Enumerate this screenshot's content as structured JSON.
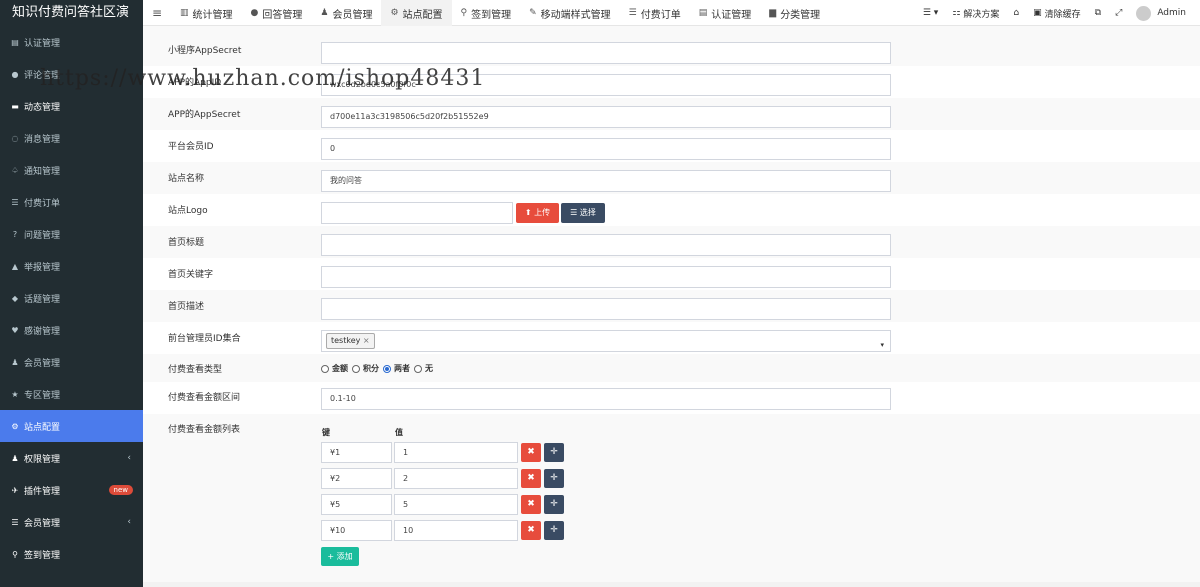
{
  "app": {
    "title": "知识付费问答社区演"
  },
  "topnav": {
    "items": [
      {
        "icon": "bar-chart-icon",
        "glyph": "▥",
        "label": "统计管理"
      },
      {
        "icon": "comment-icon",
        "glyph": "●",
        "label": "回答管理"
      },
      {
        "icon": "user-icon",
        "glyph": "♟",
        "label": "会员管理"
      },
      {
        "icon": "cogs-icon",
        "glyph": "⚙",
        "label": "站点配置"
      },
      {
        "icon": "map-marker-icon",
        "glyph": "⚲",
        "label": "签到管理"
      },
      {
        "icon": "magic-icon",
        "glyph": "✎",
        "label": "移动端样式管理"
      },
      {
        "icon": "list-icon",
        "glyph": "☰",
        "label": "付费订单"
      },
      {
        "icon": "id-card-icon",
        "glyph": "▤",
        "label": "认证管理"
      },
      {
        "icon": "folder-icon",
        "glyph": "▆",
        "label": "分类管理"
      }
    ],
    "right": {
      "menu_glyph": "☰ ▾",
      "solution_label": "解决方案",
      "home_glyph": "⌂",
      "clear_cache_label": "清除缓存",
      "translate_glyph": "⧉",
      "fullscreen_glyph": "⤢",
      "user_name": "Admin"
    }
  },
  "sidebar": {
    "items": [
      {
        "icon": "id-card-icon",
        "glyph": "▤",
        "label": "认证管理"
      },
      {
        "icon": "comments-icon",
        "glyph": "●",
        "label": "评论管理"
      },
      {
        "icon": "feed-icon",
        "glyph": "▬",
        "label": "动态管理"
      },
      {
        "icon": "message-icon",
        "glyph": "◌",
        "label": "消息管理"
      },
      {
        "icon": "bell-icon",
        "glyph": "♤",
        "label": "通知管理"
      },
      {
        "icon": "list-icon",
        "glyph": "☰",
        "label": "付费订单"
      },
      {
        "icon": "question-icon",
        "glyph": "?",
        "label": "问题管理"
      },
      {
        "icon": "warning-icon",
        "glyph": "▲",
        "label": "举报管理"
      },
      {
        "icon": "tag-icon",
        "glyph": "◆",
        "label": "话题管理"
      },
      {
        "icon": "heart-icon",
        "glyph": "♥",
        "label": "感谢管理"
      },
      {
        "icon": "user-icon",
        "glyph": "♟",
        "label": "会员管理"
      },
      {
        "icon": "star-icon",
        "glyph": "★",
        "label": "专区管理"
      },
      {
        "icon": "cogs-icon",
        "glyph": "⚙",
        "label": "站点配置"
      },
      {
        "icon": "users-icon",
        "glyph": "♟",
        "label": "权限管理"
      },
      {
        "icon": "plugin-icon",
        "glyph": "✈",
        "label": "插件管理"
      },
      {
        "icon": "list-icon",
        "glyph": "☰",
        "label": "会员管理"
      },
      {
        "icon": "map-marker-icon",
        "glyph": "⚲",
        "label": "签到管理"
      }
    ],
    "badge_new": "new",
    "chevron": "‹"
  },
  "form": {
    "miniprogram_secret": {
      "label": "小程序AppSecret",
      "value": ""
    },
    "app_appid": {
      "label": "APP的AppID",
      "value": "wxc0d2bd0c5a0f0f0c"
    },
    "app_secret": {
      "label": "APP的AppSecret",
      "value": "d700e11a3c3198506c5d20f2b51552e9"
    },
    "platform_member_id": {
      "label": "平台会员ID",
      "value": "0"
    },
    "site_name": {
      "label": "站点名称",
      "value": "我的问答"
    },
    "site_logo": {
      "label": "站点Logo",
      "value": "",
      "upload_label": "上传",
      "choose_label": "选择",
      "upload_glyph": "⬆",
      "choose_glyph": "☰"
    },
    "home_title": {
      "label": "首页标题",
      "value": ""
    },
    "home_keywords": {
      "label": "首页关键字",
      "value": ""
    },
    "home_description": {
      "label": "首页描述",
      "value": ""
    },
    "admin_ids": {
      "label": "前台管理员ID集合",
      "tag": "testkey",
      "tag_remove": "×",
      "caret": "▾"
    },
    "pay_view_type": {
      "label": "付费查看类型",
      "options": [
        {
          "label": "金额",
          "checked": false
        },
        {
          "label": "积分",
          "checked": false
        },
        {
          "label": "两者",
          "checked": true
        },
        {
          "label": "无",
          "checked": false
        }
      ]
    },
    "pay_amount_range": {
      "label": "付费查看金额区间",
      "value": "0.1-10"
    },
    "pay_amount_list": {
      "label": "付费查看金额列表",
      "key_header": "键",
      "value_header": "值",
      "rows": [
        {
          "key": "¥1",
          "value": "1"
        },
        {
          "key": "¥2",
          "value": "2"
        },
        {
          "key": "¥5",
          "value": "5"
        },
        {
          "key": "¥10",
          "value": "10"
        }
      ],
      "remove_glyph": "✖",
      "move_glyph": "✛",
      "add_label": "添加",
      "add_glyph": "+"
    }
  },
  "watermark": "https://www.huzhan.com/ishop48431",
  "colors": {
    "sidebar_bg": "#222d32",
    "active": "#4b7bec",
    "danger": "#e74c3c",
    "dark_btn": "#3a4b63",
    "success": "#1abc9c"
  }
}
